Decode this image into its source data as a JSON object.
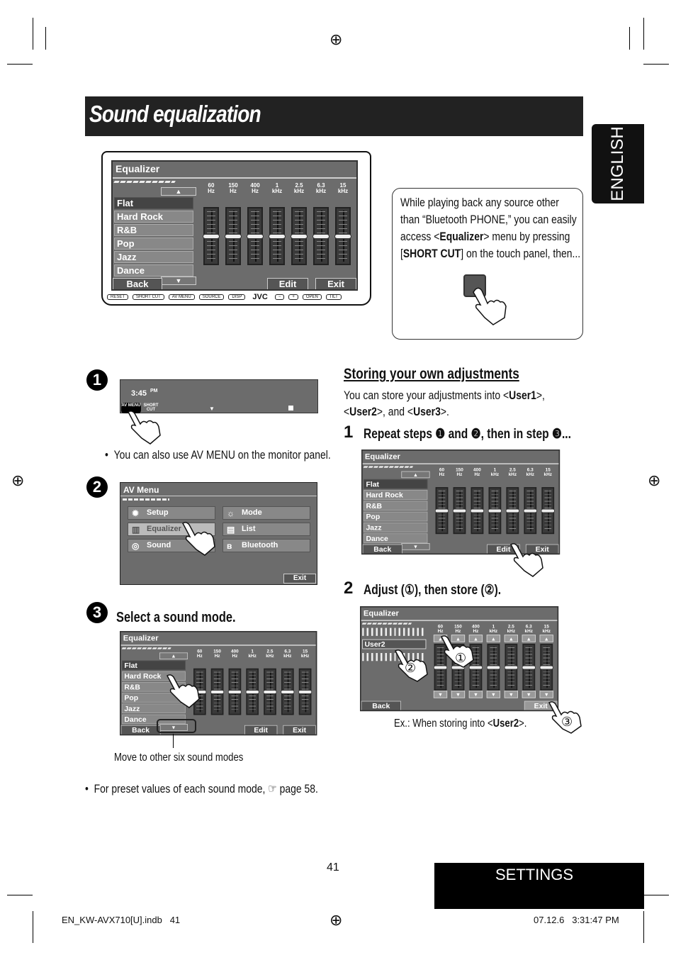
{
  "header": {
    "title": "Sound equalization",
    "side_tab": "ENGLISH"
  },
  "eq": {
    "title": "Equalizer",
    "bands": [
      {
        "f": "60",
        "u": "Hz"
      },
      {
        "f": "150",
        "u": "Hz"
      },
      {
        "f": "400",
        "u": "Hz"
      },
      {
        "f": "1",
        "u": "kHz"
      },
      {
        "f": "2.5",
        "u": "kHz"
      },
      {
        "f": "6.3",
        "u": "kHz"
      },
      {
        "f": "15",
        "u": "kHz"
      }
    ],
    "modes": [
      "Flat",
      "Hard Rock",
      "R&B",
      "Pop",
      "Jazz",
      "Dance"
    ],
    "selected_mode": "Flat",
    "back": "Back",
    "edit": "Edit",
    "exit": "Exit",
    "user2": "User2"
  },
  "device": {
    "buttons": [
      "RESET",
      "SHORT CUT",
      "AV MENU",
      "SOURCE",
      "DISP",
      "JVC",
      "−",
      "+",
      "OPEN",
      "TILT"
    ]
  },
  "callout": {
    "t1": "While playing back any source other",
    "t2": "than “Bluetooth PHONE,” you can easily",
    "t3a": "access <",
    "t3b": "Equalizer",
    "t3c": "> menu by pressing",
    "t4a": "[",
    "t4b": "SHORT CUT",
    "t4c": "] on the touch panel, then..."
  },
  "step1": {
    "num": "1",
    "time": "3:45",
    "pm": "PM",
    "av_menu": "AV MENU",
    "short_cut": "SHORT CUT",
    "note": "You can also use AV MENU on the monitor panel."
  },
  "step2": {
    "num": "2",
    "title": "AV Menu",
    "items": [
      {
        "label": "Setup",
        "icon": "gear-icon"
      },
      {
        "label": "Mode",
        "icon": "mode-icon"
      },
      {
        "label": "Equalizer",
        "icon": "equalizer-icon"
      },
      {
        "label": "List",
        "icon": "list-icon"
      },
      {
        "label": "Sound",
        "icon": "sound-icon"
      },
      {
        "label": "Bluetooth",
        "icon": "bluetooth-icon"
      }
    ],
    "exit": "Exit"
  },
  "step3": {
    "num": "3",
    "heading": "Select a sound mode.",
    "caption": "Move to other six sound modes"
  },
  "preset_note": "For preset values of each sound mode, ☞ page 58.",
  "storing": {
    "heading": "Storing your own adjustments",
    "l1a": "You can store your adjustments into <",
    "l1b": "User1",
    "l1c": ">,",
    "l2a": "<",
    "l2b": "User2",
    "l2c": ">, and <",
    "l2d": "User3",
    "l2e": ">.",
    "s1num": "1",
    "s1": "Repeat steps ❶ and ❷, then in step ❸...",
    "s2num": "2",
    "s2": "Adjust (①), then store (②).",
    "example_a": "Ex.: When storing into <",
    "example_b": "User2",
    "example_c": ">.",
    "markers": [
      "①",
      "②",
      "③"
    ]
  },
  "footer": {
    "page": "41",
    "section": "SETTINGS",
    "file": "EN_KW-AVX710[U].indb   41",
    "stamp": "07.12.6   3:31:47 PM"
  }
}
